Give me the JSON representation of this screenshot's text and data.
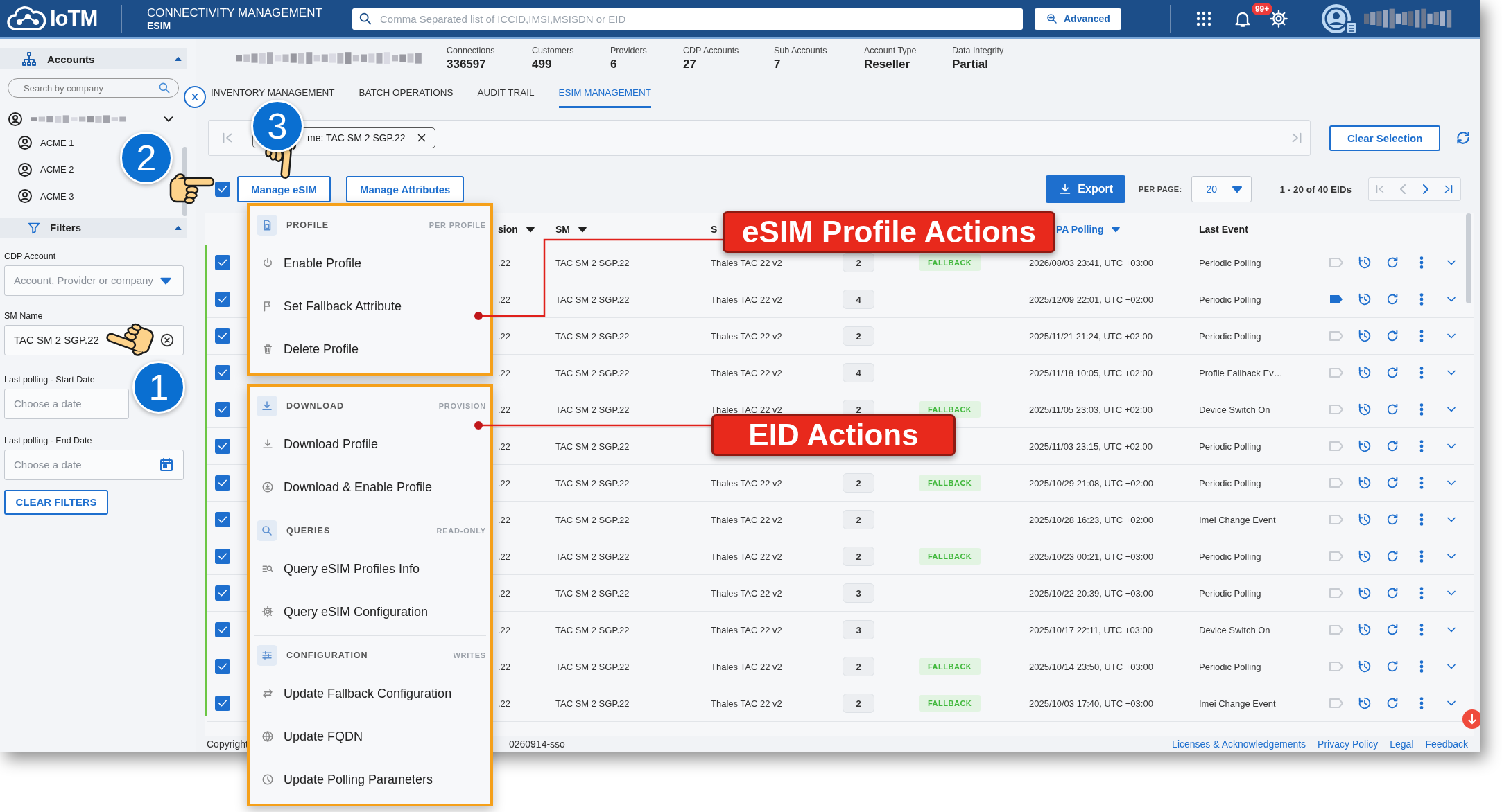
{
  "topbar": {
    "logo": "IoTM",
    "product": "CONNECTIVITY MANAGEMENT",
    "module": "ESIM",
    "search": {
      "placeholder": "Comma Separated list of ICCID,IMSI,MSISDN or EID"
    },
    "advanced": "Advanced",
    "notifications": "99+"
  },
  "sidebar": {
    "accounts_title": "Accounts",
    "search": {
      "placeholder": "Search by company"
    },
    "accounts": [
      {
        "name": "ACME 1"
      },
      {
        "name": "ACME 2"
      },
      {
        "name": "ACME 3"
      }
    ],
    "filters_title": "Filters",
    "filters": [
      {
        "kind": "select",
        "label": "CDP Account",
        "placeholder": "Account, Provider or company"
      },
      {
        "kind": "text",
        "label": "SM Name",
        "value": "TAC SM 2 SGP.22"
      },
      {
        "kind": "date",
        "label": "Last polling - Start Date",
        "placeholder": "Choose a date",
        "calendar_icon": false
      },
      {
        "kind": "date",
        "label": "Last polling - End Date",
        "placeholder": "Choose a date",
        "calendar_icon": true
      }
    ],
    "clear_button": "CLEAR FILTERS"
  },
  "stats": [
    {
      "label": "Connections",
      "value": "336597"
    },
    {
      "label": "Customers",
      "value": "499"
    },
    {
      "label": "Providers",
      "value": "6"
    },
    {
      "label": "CDP Accounts",
      "value": "27"
    },
    {
      "label": "Sub Accounts",
      "value": "7"
    },
    {
      "label": "Account Type",
      "value": "Reseller"
    },
    {
      "label": "Data Integrity",
      "value": "Partial"
    }
  ],
  "tabs": [
    {
      "label": "INVENTORY MANAGEMENT",
      "selected": false
    },
    {
      "label": "BATCH OPERATIONS",
      "selected": false
    },
    {
      "label": "AUDIT TRAIL",
      "selected": false
    },
    {
      "label": "ESIM MANAGEMENT",
      "selected": true
    }
  ],
  "filter_chip": {
    "label": "me: TAC SM 2 SGP.22"
  },
  "clear_selection": "Clear Selection",
  "toolbar": {
    "select_all": {
      "checked": true
    },
    "buttons": [
      "Manage eSIM",
      "Manage Attributes"
    ],
    "export": "Export",
    "per_page_label": "PER PAGE:",
    "per_page": "20",
    "range": "1 - 20 of 40 EIDs"
  },
  "table": {
    "columns": [
      {
        "label": "sion",
        "sortable": true,
        "sorted": false
      },
      {
        "label": "SM",
        "sortable": true,
        "sorted": false
      },
      {
        "label": "S",
        "sortable": false,
        "sorted": false
      },
      {
        "label": "PA Polling",
        "sortable": true,
        "sorted": true
      },
      {
        "label": "Last Event",
        "sortable": false,
        "sorted": false
      }
    ],
    "rows": [
      {
        "checked": true,
        "column_2": ".22",
        "sm": "TAC SM 2 SGP.22",
        "column_4": "Thales TAC 22 v2",
        "profiles": "2",
        "fallback": "FALLBACK",
        "polling": "2026/08/03 23:41, UTC +03:00",
        "last_event": "Periodic Polling",
        "tagged": false
      },
      {
        "checked": true,
        "column_2": ".22",
        "sm": "TAC SM 2 SGP.22",
        "column_4": "Thales TAC 22 v2",
        "profiles": "4",
        "polling": "2025/12/09 22:01, UTC +02:00",
        "last_event": "Periodic Polling",
        "tagged": true
      },
      {
        "checked": true,
        "column_2": ".22",
        "sm": "TAC SM 2 SGP.22",
        "column_4": "Thales TAC 22 v2",
        "profiles": "2",
        "polling": "2025/11/21 21:24, UTC +02:00",
        "last_event": "Periodic Polling",
        "tagged": false
      },
      {
        "checked": true,
        "column_2": ".22",
        "sm": "TAC SM 2 SGP.22",
        "column_4": "Thales TAC 22 v2",
        "profiles": "4",
        "polling": "2025/11/18 10:05, UTC +02:00",
        "last_event": "Profile Fallback Ev…",
        "tagged": false
      },
      {
        "checked": true,
        "column_2": ".22",
        "sm": "TAC SM 2 SGP.22",
        "column_4": "Thales TAC 22 v2",
        "profiles": "2",
        "fallback": "FALLBACK",
        "polling": "2025/11/05 23:03, UTC +02:00",
        "last_event": "Device Switch On",
        "tagged": false
      },
      {
        "checked": true,
        "column_2": ".22",
        "sm": "TAC SM 2 SGP.22",
        "polling": "2025/11/03 23:15, UTC +02:00",
        "last_event": "Periodic Polling",
        "tagged": false
      },
      {
        "checked": true,
        "column_2": ".22",
        "sm": "TAC SM 2 SGP.22",
        "column_4": "Thales TAC 22 v2",
        "profiles": "2",
        "fallback": "FALLBACK",
        "polling": "2025/10/29 21:08, UTC +02:00",
        "last_event": "Periodic Polling",
        "tagged": false
      },
      {
        "checked": true,
        "column_2": ".22",
        "sm": "TAC SM 2 SGP.22",
        "column_4": "Thales TAC 22 v2",
        "profiles": "2",
        "polling": "2025/10/28 16:23, UTC +02:00",
        "last_event": "Imei Change Event",
        "tagged": false
      },
      {
        "checked": true,
        "column_2": ".22",
        "sm": "TAC SM 2 SGP.22",
        "column_4": "Thales TAC 22 v2",
        "profiles": "2",
        "fallback": "FALLBACK",
        "polling": "2025/10/23 00:21, UTC +03:00",
        "last_event": "Periodic Polling",
        "tagged": false
      },
      {
        "checked": true,
        "column_2": ".22",
        "sm": "TAC SM 2 SGP.22",
        "column_4": "Thales TAC 22 v2",
        "profiles": "3",
        "polling": "2025/10/22 20:39, UTC +03:00",
        "last_event": "Periodic Polling",
        "tagged": false
      },
      {
        "checked": true,
        "column_2": ".22",
        "sm": "TAC SM 2 SGP.22",
        "column_4": "Thales TAC 22 v2",
        "profiles": "3",
        "polling": "2025/10/17 22:11, UTC +03:00",
        "last_event": "Device Switch On",
        "tagged": false
      },
      {
        "checked": true,
        "column_2": ".22",
        "sm": "TAC SM 2 SGP.22",
        "column_4": "Thales TAC 22 v2",
        "profiles": "2",
        "fallback": "FALLBACK",
        "polling": "2025/10/14 23:50, UTC +03:00",
        "last_event": "Periodic Polling",
        "tagged": false
      },
      {
        "checked": true,
        "column_2": ".22",
        "sm": "TAC SM 2 SGP.22",
        "column_4": "Thales TAC 22 v2",
        "profiles": "2",
        "fallback": "FALLBACK",
        "polling": "2025/10/03 17:40, UTC +03:00",
        "last_event": "Imei Change Event",
        "tagged": false
      }
    ]
  },
  "footer": {
    "copyright": "Copyright",
    "version": "0260914-sso",
    "links": [
      "Licenses & Acknowledgements",
      "Privacy Policy",
      "Legal",
      "Feedback"
    ]
  },
  "menu": {
    "panels": [
      {
        "sections": [
          {
            "kind": "profile",
            "title": "PROFILE",
            "note": "PER PROFILE",
            "items": [
              {
                "kind": "power",
                "label": "Enable Profile"
              },
              {
                "kind": "flag",
                "label": "Set Fallback Attribute"
              },
              {
                "kind": "trash",
                "label": "Delete Profile"
              }
            ]
          }
        ]
      },
      {
        "sections": [
          {
            "kind": "download",
            "title": "DOWNLOAD",
            "note": "PROVISION",
            "items": [
              {
                "kind": "download",
                "label": "Download Profile"
              },
              {
                "kind": "download-circle",
                "label": "Download & Enable Profile"
              }
            ]
          },
          {
            "kind": "queries",
            "title": "QUERIES",
            "note": "READ-ONLY",
            "items": [
              {
                "kind": "list-search",
                "label": "Query eSIM Profiles Info"
              },
              {
                "kind": "gear",
                "label": "Query eSIM Configuration"
              }
            ]
          },
          {
            "kind": "configuration",
            "title": "CONFIGURATION",
            "note": "WRITES",
            "items": [
              {
                "kind": "arrows",
                "label": "Update Fallback Configuration"
              },
              {
                "kind": "globe",
                "label": "Update FQDN"
              },
              {
                "kind": "clock",
                "label": "Update Polling Parameters"
              }
            ]
          }
        ]
      }
    ]
  },
  "annotations": {
    "steps": [
      {
        "number": "1"
      },
      {
        "number": "2"
      },
      {
        "number": "3"
      }
    ],
    "callouts": [
      {
        "label": "eSIM Profile Actions"
      },
      {
        "label": "EID Actions"
      }
    ]
  }
}
